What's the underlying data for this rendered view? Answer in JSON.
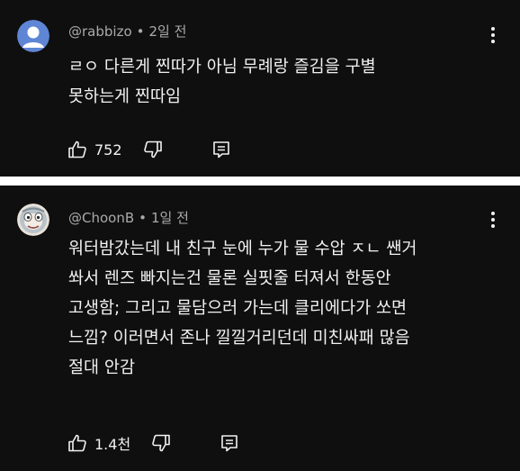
{
  "comments": [
    {
      "author": "@rabbizo",
      "separator": "•",
      "time": "2일 전",
      "lines": [
        "ㄹㅇ 다른게 찐따가 아님 무례랑 즐김을 구별",
        "못하는게 찐따임"
      ],
      "likes": "752",
      "avatar": "default-avatar"
    },
    {
      "author": "@ChoonB",
      "separator": "•",
      "time": "1일 전",
      "lines": [
        "워터밤갔는데 내 친구 눈에 누가 물 수압 ㅈㄴ 쌘거",
        "쏴서 렌즈 빠지는건 물론 실핏줄 터져서 한동안",
        "고생함; 그리고 물담으러 가는데 클리에다가 쏘면",
        "느낌? 이러면서 존나 낄낄거리던데 미친싸패 많음",
        "절대 안감"
      ],
      "likes": "1.4천",
      "avatar": "character-avatar"
    }
  ],
  "colors": {
    "background": "#0f0f0f",
    "text": "#f1f1f1",
    "meta": "#aaaaaa",
    "divider": "#ffffff",
    "avatar_default": "#5f86d4"
  },
  "icons": [
    "like-icon",
    "dislike-icon",
    "reply-icon",
    "more-options-icon"
  ]
}
